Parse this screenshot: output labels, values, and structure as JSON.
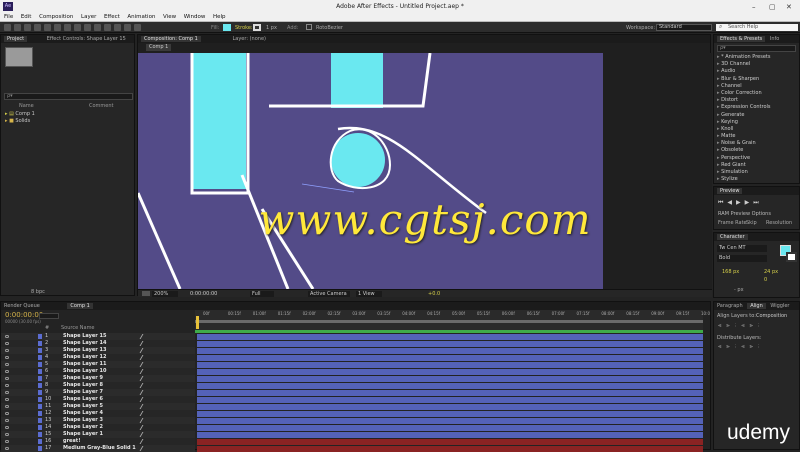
{
  "app": {
    "title": "Adobe After Effects - Untitled Project.aep *",
    "logo": "Ae"
  },
  "menu": [
    "File",
    "Edit",
    "Composition",
    "Layer",
    "Effect",
    "Animation",
    "View",
    "Window",
    "Help"
  ],
  "toolbar": {
    "fill_label": "Fill:",
    "stroke_label": "Stroke:",
    "stroke_width": "1 px",
    "add_label": "Add:",
    "rotobezier_label": "RotoBezier",
    "workspace_label": "Workspace:",
    "workspace_value": "Standard",
    "search_placeholder": "Search Help"
  },
  "project": {
    "tab_project": "Project",
    "tab_effect_controls": "Effect Controls: Shape Layer 15",
    "search_placeholder": "ρ▾",
    "col_name": "Name",
    "col_comment": "Comment",
    "items": [
      {
        "name": "Comp 1"
      },
      {
        "name": "Solids"
      }
    ],
    "bpc": "8 bpc"
  },
  "viewer": {
    "tab": "Composition: Comp 1",
    "layer_tab": "Layer: (none)",
    "breadcrumb": "Comp 1",
    "watermark": "www.cgtsj.com",
    "zoom": "200%",
    "timecode": "0:00:00:00",
    "resolution": "Full",
    "camera": "Active Camera",
    "views": "1 View",
    "exposure": "+0.0"
  },
  "effects": {
    "tab": "Effects & Presets",
    "tab2": "Info",
    "search_placeholder": "ρ▾",
    "items": [
      "* Animation Presets",
      "3D Channel",
      "Audio",
      "Blur & Sharpen",
      "Channel",
      "Color Correction",
      "Distort",
      "Expression Controls",
      "Generate",
      "Keying",
      "Knoll",
      "Matte",
      "Noise & Grain",
      "Obsolete",
      "Perspective",
      "Red Giant",
      "Simulation",
      "Stylize"
    ]
  },
  "preview": {
    "tab": "Preview",
    "ram_options": "RAM Preview Options",
    "frame_rate_label": "Frame Rate",
    "skip_label": "Skip",
    "resolution_label": "Resolution"
  },
  "character": {
    "tab": "Character",
    "font": "Tw Cen MT",
    "style": "Bold",
    "size": "168 px",
    "leading": "24 px",
    "tracking": "0",
    "stroke_width": "- px"
  },
  "align": {
    "tab_paragraph": "Paragraph",
    "tab_align": "Align",
    "tab_wiggler": "Wiggler",
    "align_layers_to": "Align Layers to:",
    "align_target": "Composition",
    "distribute_label": "Distribute Layers:"
  },
  "timeline": {
    "tab_render": "Render Queue",
    "tab_comp": "Comp 1",
    "timecode": "0:00:00:00",
    "fps": "00000 (30.00 fps)",
    "col_num": "#",
    "col_source": "Source Name",
    "ruler": [
      "00f",
      "00:15f",
      "01:00f",
      "01:15f",
      "02:00f",
      "02:15f",
      "03:00f",
      "03:15f",
      "04:00f",
      "04:15f",
      "05:00f",
      "05:15f",
      "06:00f",
      "06:15f",
      "07:00f",
      "07:15f",
      "08:00f",
      "08:15f",
      "09:00f",
      "09:15f",
      "10:0"
    ],
    "layers": [
      {
        "num": "1",
        "name": "Shape Layer 15"
      },
      {
        "num": "2",
        "name": "Shape Layer 14"
      },
      {
        "num": "3",
        "name": "Shape Layer 13"
      },
      {
        "num": "4",
        "name": "Shape Layer 12"
      },
      {
        "num": "5",
        "name": "Shape Layer 11"
      },
      {
        "num": "6",
        "name": "Shape Layer 10"
      },
      {
        "num": "7",
        "name": "Shape Layer 9"
      },
      {
        "num": "8",
        "name": "Shape Layer 8"
      },
      {
        "num": "9",
        "name": "Shape Layer 7"
      },
      {
        "num": "10",
        "name": "Shape Layer 6"
      },
      {
        "num": "11",
        "name": "Shape Layer 5"
      },
      {
        "num": "12",
        "name": "Shape Layer 4"
      },
      {
        "num": "13",
        "name": "Shape Layer 3"
      },
      {
        "num": "14",
        "name": "Shape Layer 2"
      },
      {
        "num": "15",
        "name": "Shape Layer 1"
      },
      {
        "num": "16",
        "name": "great!"
      },
      {
        "num": "17",
        "name": "Medium Gray-Blue Solid 1"
      }
    ]
  },
  "brand": {
    "udemy": "udemy"
  },
  "colors": {
    "comp_bg": "#534b88",
    "cyan": "#6ae8f0",
    "layer_label": "#5b6cd0",
    "track_red": "#8a2323",
    "watermark": "#ffe83a"
  }
}
